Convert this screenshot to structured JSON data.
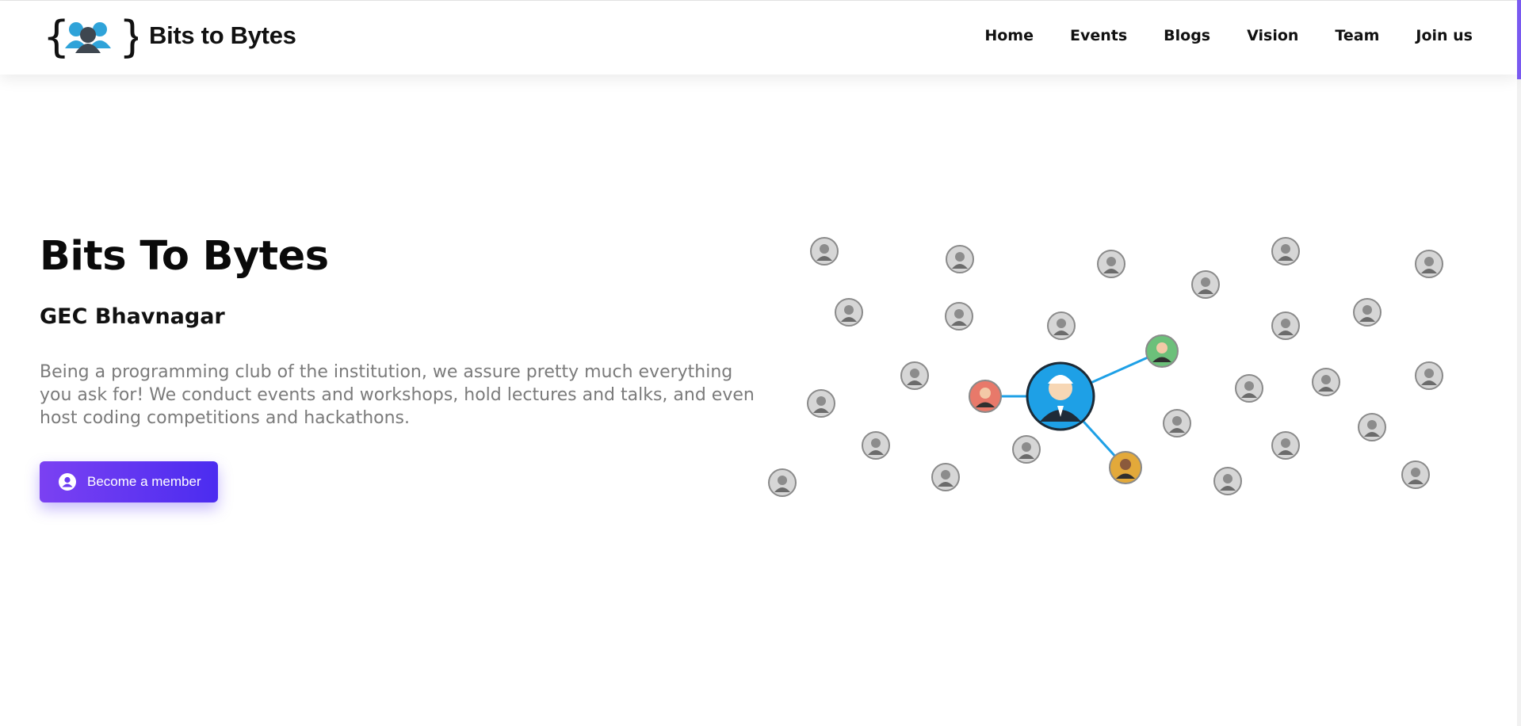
{
  "header": {
    "brand": "Bits to Bytes",
    "logo_icon": "people-in-braces-logo",
    "nav": [
      {
        "label": "Home"
      },
      {
        "label": "Events"
      },
      {
        "label": "Blogs"
      },
      {
        "label": "Vision"
      },
      {
        "label": "Team"
      },
      {
        "label": "Join us"
      }
    ]
  },
  "hero": {
    "title": "Bits To Bytes",
    "subtitle": "GEC Bhavnagar",
    "description": "Being a programming club of the institution, we assure pretty much everything you ask for! We conduct events and workshops, hold lectures and talks, and even host coding competitions and hackathons.",
    "cta_label": "Become a member",
    "cta_icon": "user-circle-icon"
  },
  "illustration": {
    "name": "people-network-illustration",
    "accent_colors": {
      "hub": "#1ea0e6",
      "link": "#1ea0e6",
      "left": "#e8796a",
      "top": "#6cc07a",
      "bottom": "#e3a93a"
    }
  },
  "colors": {
    "accent_start": "#7b41f2",
    "accent_end": "#4b2cf0",
    "desc_text": "#7b7b7b"
  }
}
